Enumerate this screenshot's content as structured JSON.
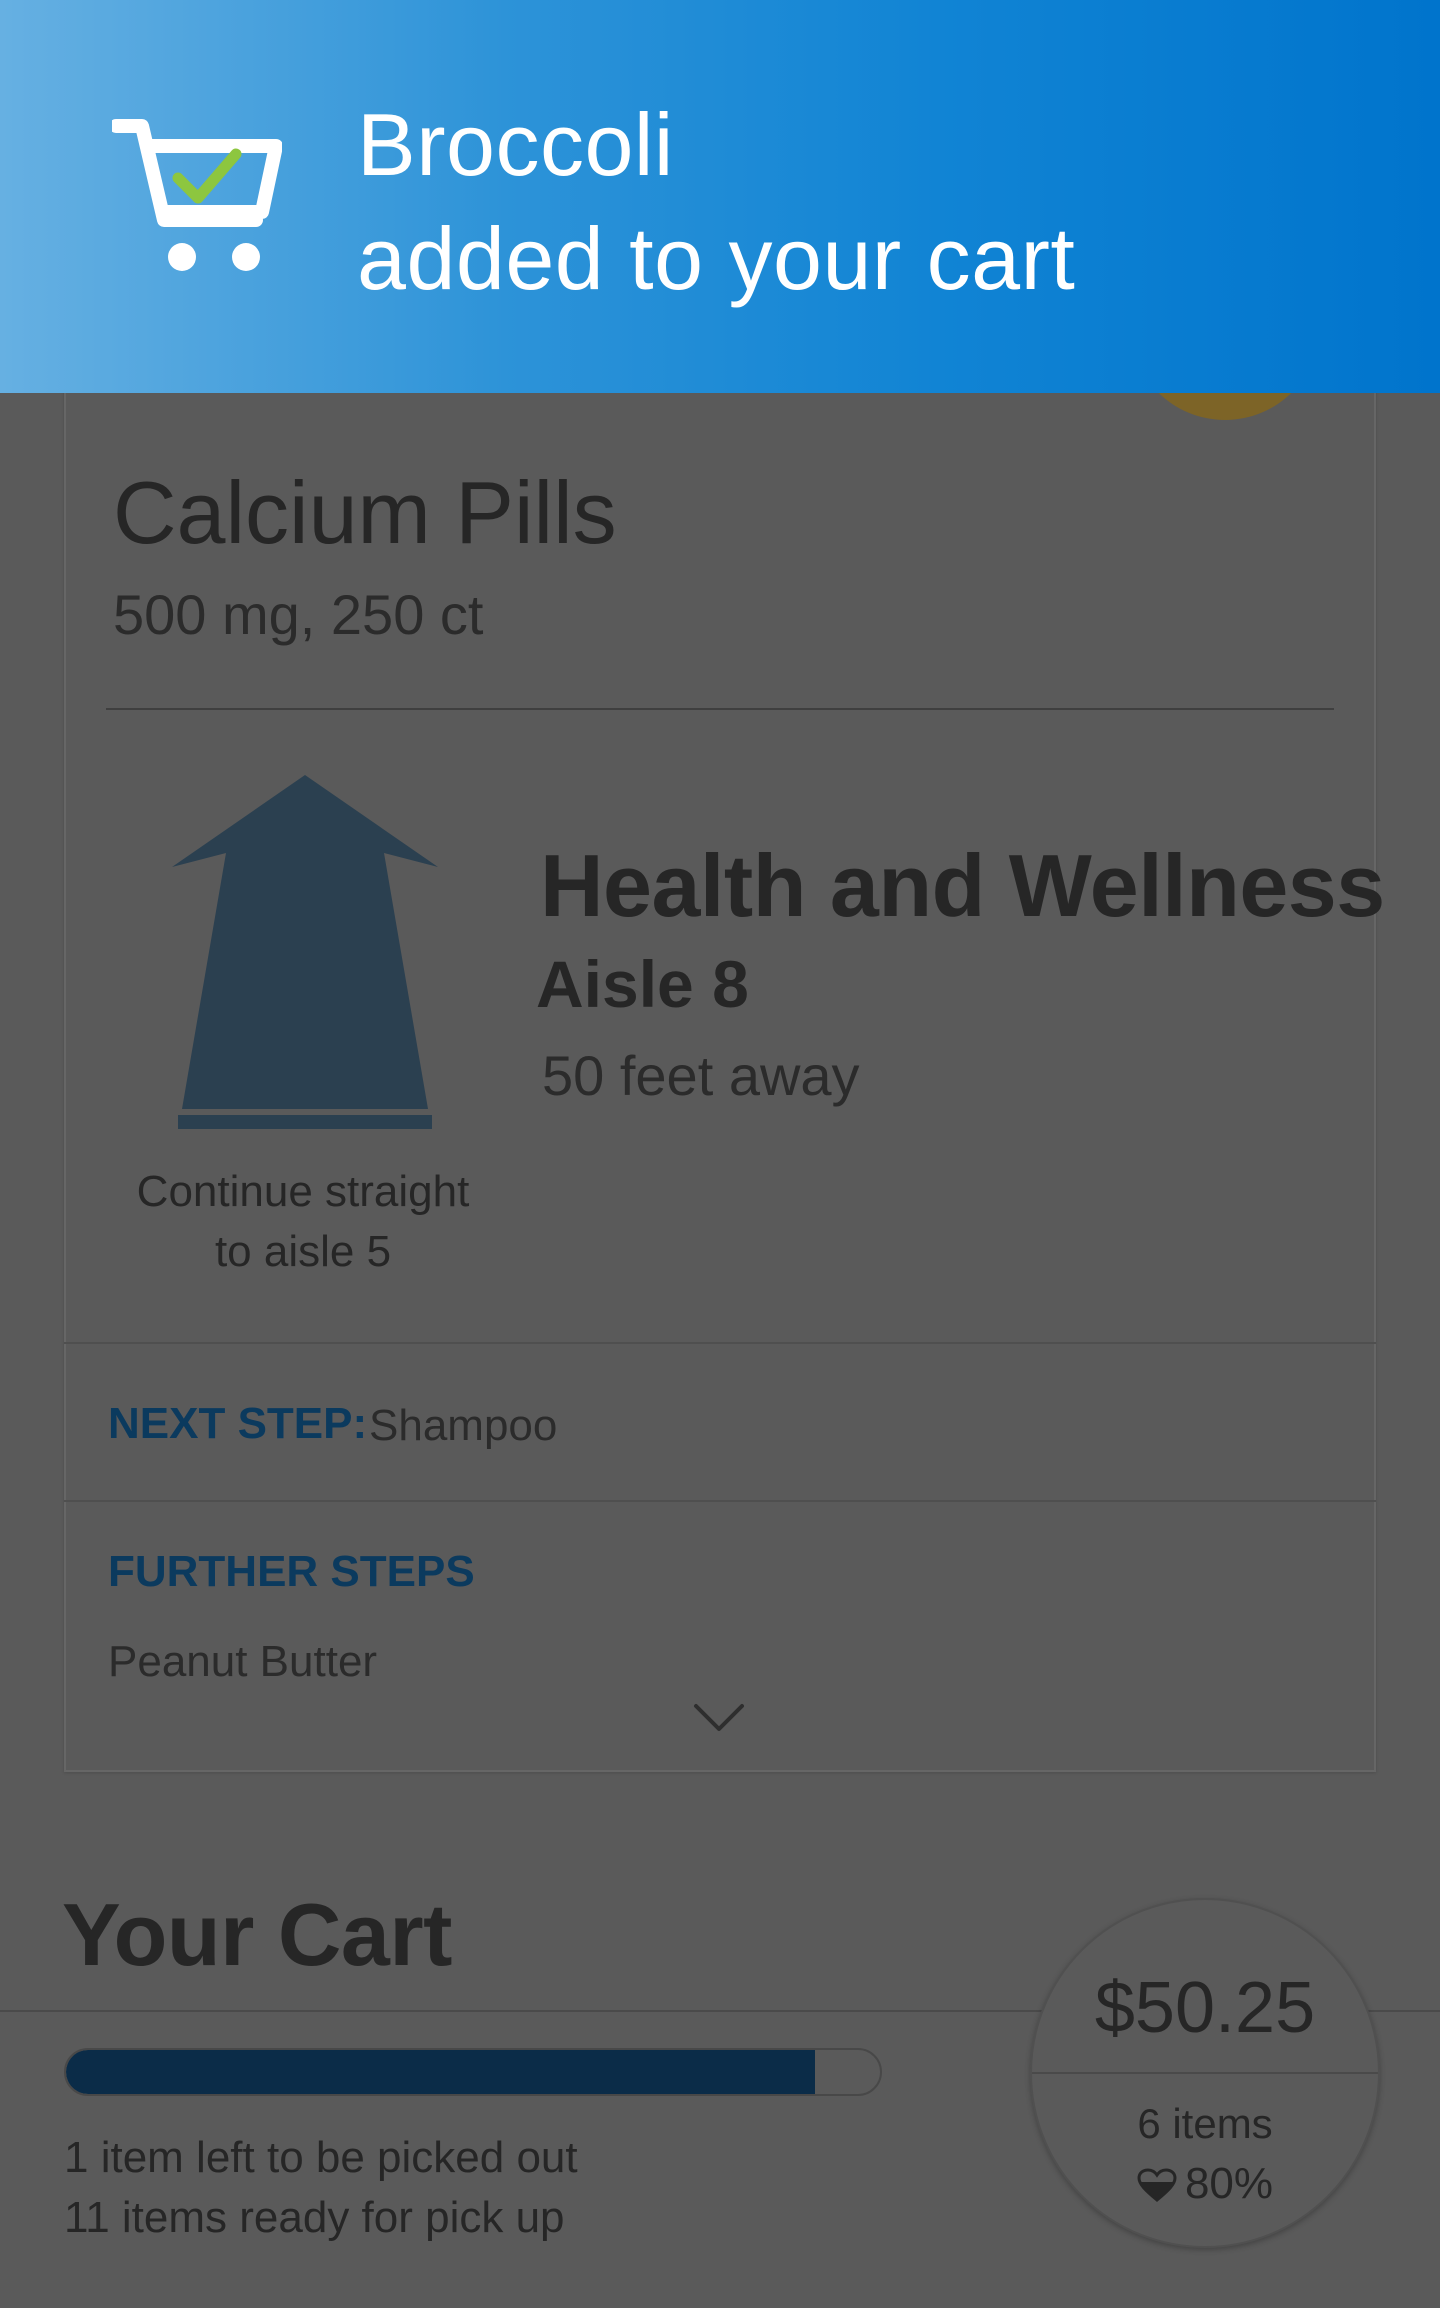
{
  "toast": {
    "icon": "cart-check-icon",
    "product": "Broccoli",
    "message": "added to your cart",
    "colors": {
      "gradient_start": "#66b0e2",
      "gradient_end": "#0074cc",
      "check": "#8dc63f"
    }
  },
  "current_item": {
    "name": "Calcium Pills",
    "size": "500 mg, 250 ct",
    "direction_icon": "straight-arrow-icon",
    "direction_text_line1": "Continue straight",
    "direction_text_line2": "to aisle 5",
    "department": "Health and Wellness",
    "aisle": "Aisle 8",
    "distance": "50 feet away"
  },
  "steps": {
    "next_label": "NEXT STEP:",
    "next_value": "Shampoo",
    "further_label": "FURTHER STEPS",
    "further_items": [
      "Peanut Butter"
    ],
    "expand_icon": "chevron-down-icon"
  },
  "cart": {
    "title": "Your Cart",
    "progress_fraction": 0.92,
    "status_line1": "1 item left to be picked out",
    "status_line2": "11 items ready for pick up",
    "total": "$50.25",
    "items": "6 items",
    "health_icon": "heart-icon",
    "health_score": "80%"
  }
}
